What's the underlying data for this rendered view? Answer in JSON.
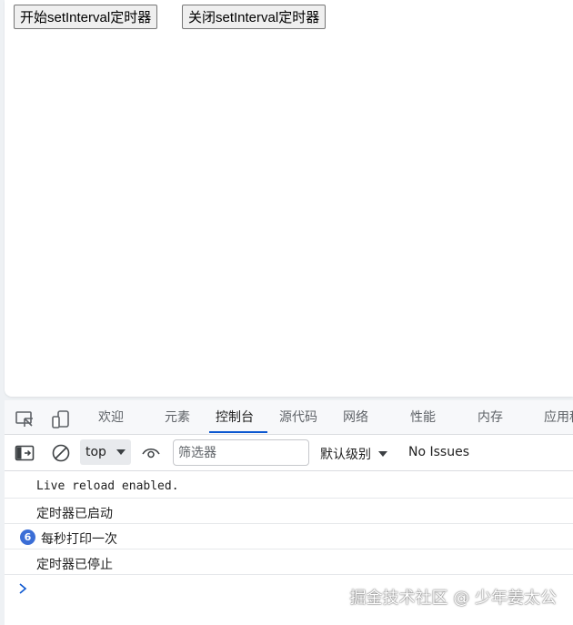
{
  "page": {
    "start_button": "开始setInterval定时器",
    "stop_button": "关闭setInterval定时器"
  },
  "devtools": {
    "tabs": [
      {
        "label": "欢迎"
      },
      {
        "label": "元素"
      },
      {
        "label": "控制台",
        "active": true
      },
      {
        "label": "源代码"
      },
      {
        "label": "网络"
      },
      {
        "label": "性能"
      },
      {
        "label": "内存"
      },
      {
        "label": "应用程序"
      }
    ],
    "toolbar": {
      "context": "top",
      "filter_placeholder": "筛选器",
      "levels": "默认级别",
      "issues": "No Issues"
    },
    "console": [
      {
        "text": "Live reload enabled."
      },
      {
        "text": "定时器已启动"
      },
      {
        "count": "6",
        "text": "每秒打印一次"
      },
      {
        "text": "定时器已停止"
      }
    ]
  },
  "watermark": "掘金技术社区 @ 少年姜太公",
  "colors": {
    "accent": "#0b57d0",
    "badge": "#3b6ed6",
    "background": "#eef1f4"
  }
}
